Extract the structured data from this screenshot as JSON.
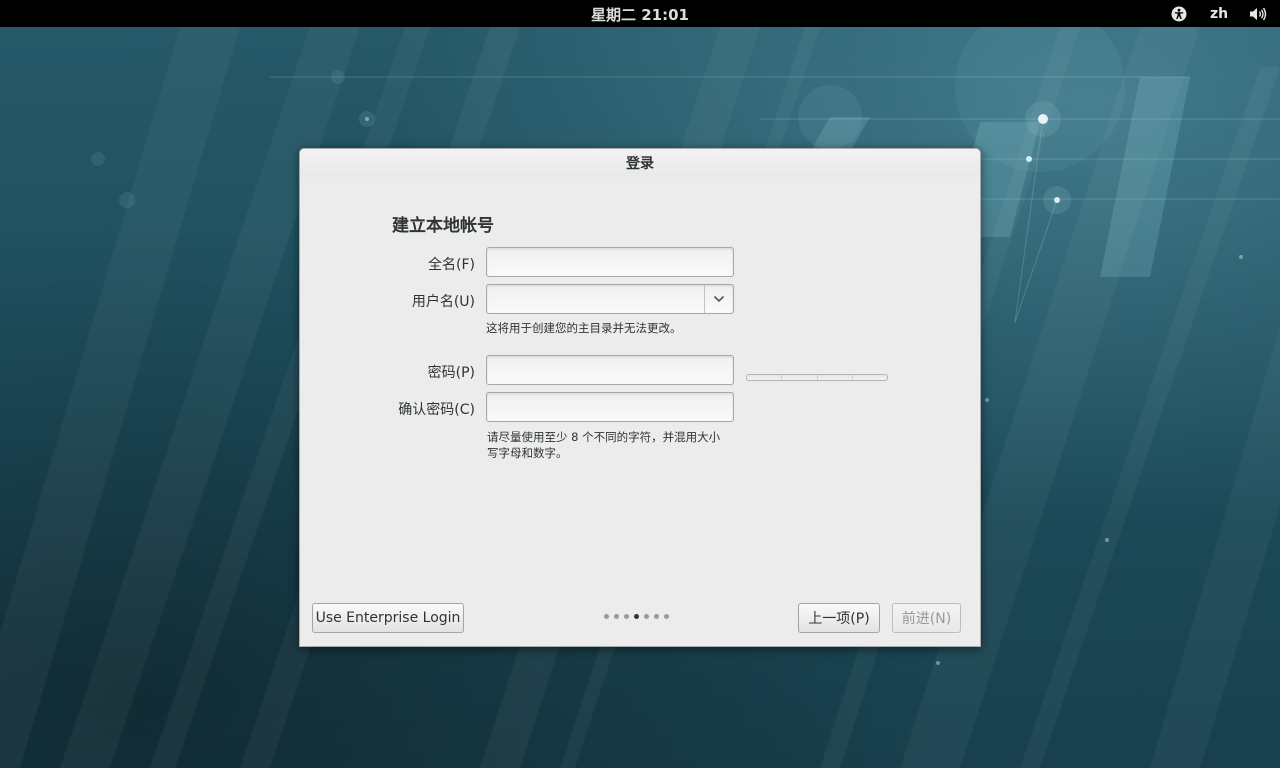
{
  "topbar": {
    "clock": "星期二 21:01",
    "language": "zh",
    "accessibility_icon": "accessibility-icon",
    "volume_icon": "volume-icon"
  },
  "dialog": {
    "title": "登录",
    "heading": "建立本地帐号",
    "full_name": {
      "label": "全名(F)",
      "value": "",
      "placeholder": ""
    },
    "username": {
      "label": "用户名(U)",
      "value": "",
      "placeholder": "",
      "hint": "这将用于创建您的主目录并无法更改。"
    },
    "password": {
      "label": "密码(P)",
      "value": "",
      "placeholder": ""
    },
    "confirm_password": {
      "label": "确认密码(C)",
      "value": "",
      "placeholder": "",
      "hint_line1": "请尽量使用至少 8 个不同的字符，并混用大小",
      "hint_line2": "写字母和数字。"
    },
    "password_strength": 0
  },
  "footer": {
    "enterprise_label": "Use Enterprise Login",
    "prev_label": "上一项(P)",
    "next_label": "前进(N)",
    "page_count": 7,
    "current_page": 4
  },
  "colors": {
    "desktop_bg": "#1d4c5b",
    "topbar_bg": "#000000",
    "dialog_bg": "#ececec",
    "text": "#2e3436",
    "disabled_text": "#9a9a9a"
  }
}
